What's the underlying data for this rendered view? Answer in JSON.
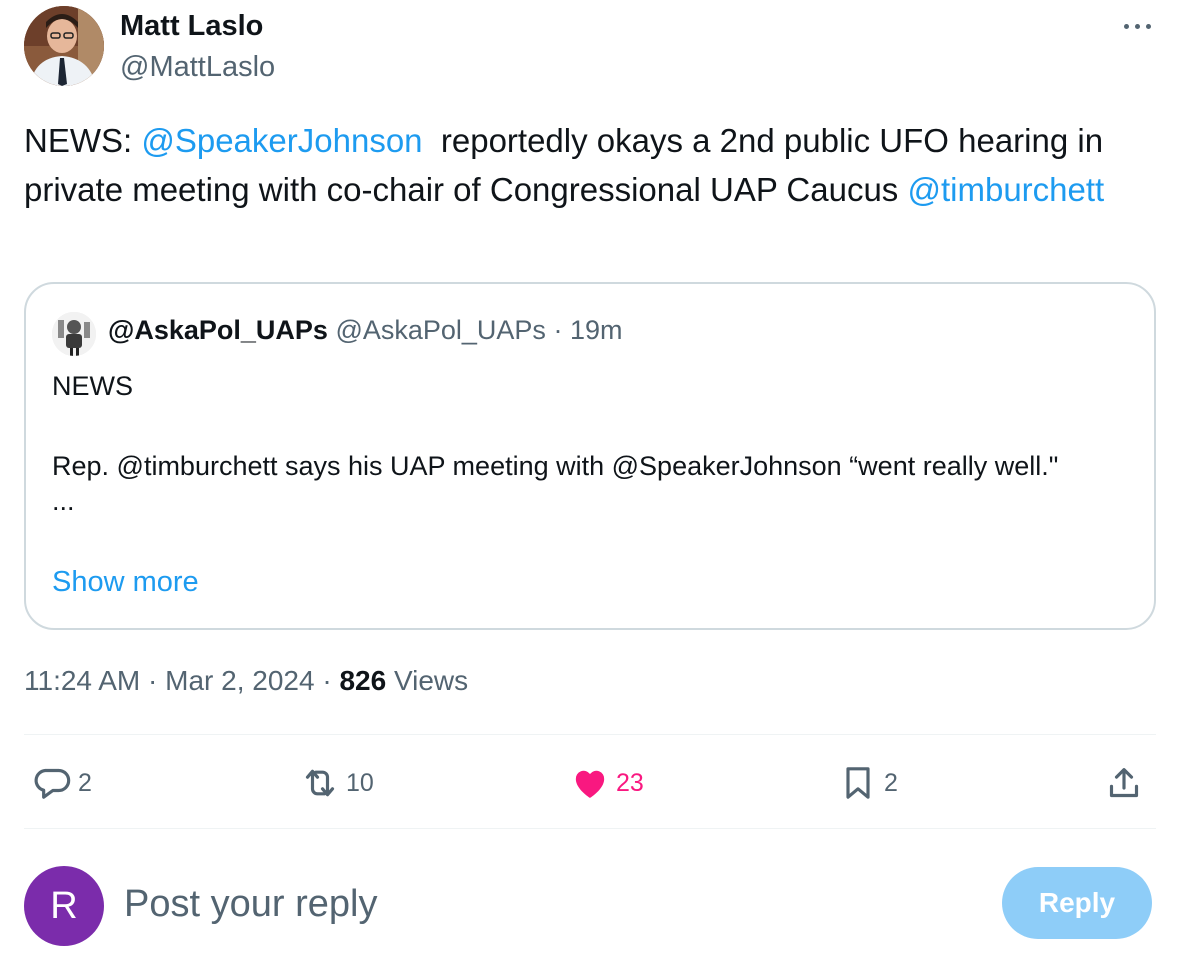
{
  "tweet": {
    "author_name": "Matt Laslo",
    "author_handle": "@MattLaslo",
    "text": {
      "prefix": "NEWS: ",
      "mention_1": "@SpeakerJohnson",
      "middle": "  reportedly okays a 2nd public UFO hearing in private meeting with co-chair of Congressional UAP Caucus ",
      "mention_2": "@timburchett"
    },
    "time": "11:24 AM",
    "date": "Mar 2, 2024",
    "views_count": "826",
    "views_label": "Views",
    "separator": "·"
  },
  "quote": {
    "name": "@AskaPol_UAPs",
    "handle": "@AskaPol_UAPs",
    "time": "19m",
    "line_1": "NEWS",
    "line_2": "Rep. @timburchett says his UAP meeting with @SpeakerJohnson “went really well.\"",
    "ellipsis": "...",
    "show_more": "Show more"
  },
  "actions": {
    "replies": "2",
    "reposts": "10",
    "likes": "23",
    "bookmarks": "2"
  },
  "reply_box": {
    "avatar_letter": "R",
    "placeholder": "Post your reply",
    "button_label": "Reply"
  },
  "colors": {
    "accent": "#1d9bf0",
    "like": "#f91880",
    "muted": "#536471",
    "reply_button_disabled": "#8ecdf8",
    "reply_avatar": "#7b2cab"
  },
  "icons": [
    "more-icon",
    "reply-icon",
    "repost-icon",
    "heart-icon",
    "bookmark-icon",
    "share-icon"
  ]
}
